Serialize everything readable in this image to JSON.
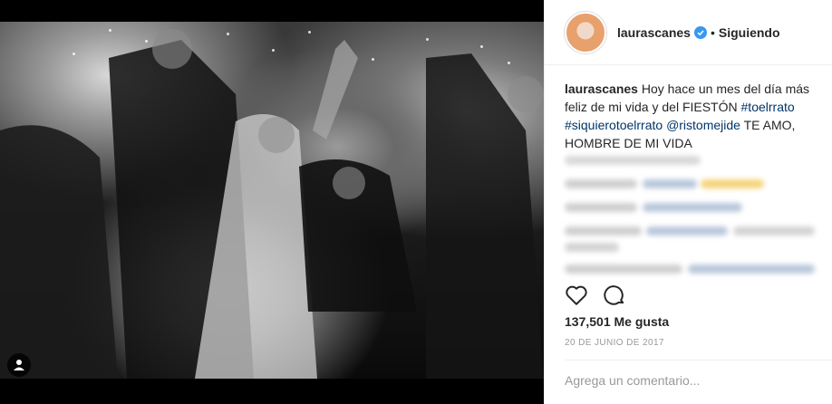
{
  "post": {
    "username": "laurascanes",
    "follow_status": "Siguiendo",
    "follow_separator": "•",
    "caption": {
      "username": "laurascanes",
      "text_1": " Hoy hace un mes del día más feliz de mi vida y del FIESTÓN ",
      "tag_1": "#toelrrato",
      "text_2": " ",
      "tag_2": "#siquierotoelrrato",
      "text_3": " ",
      "tag_3": "@ristomejide",
      "text_4": " TE AMO, HOMBRE DE MI VIDA"
    },
    "likes": "137,501 Me gusta",
    "date": "20 DE JUNIO DE 2017",
    "comment_placeholder": "Agrega un comentario..."
  },
  "icons": {
    "verified": "verified-badge-icon",
    "like": "heart-icon",
    "comment": "comment-icon",
    "user_tag": "user-tag-icon"
  },
  "colors": {
    "accent": "#3897f0",
    "link": "#003569",
    "text": "#262626",
    "muted": "#999999"
  }
}
